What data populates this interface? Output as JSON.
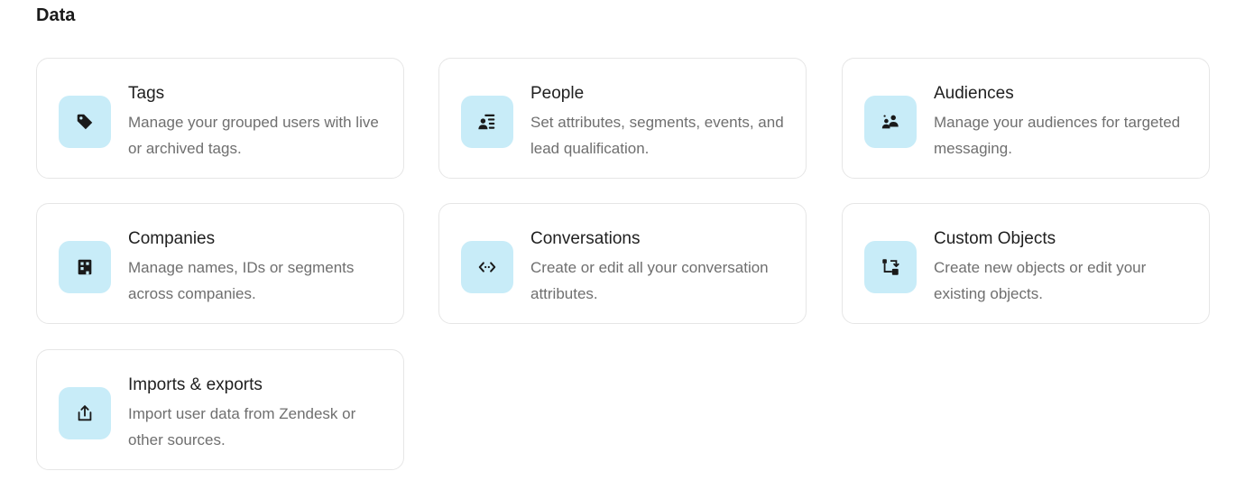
{
  "section": {
    "title": "Data"
  },
  "cards": [
    {
      "title": "Tags",
      "description": "Manage your grouped users with live or archived tags.",
      "icon": "tag-icon"
    },
    {
      "title": "People",
      "description": "Set attributes, segments, events, and lead qualification.",
      "icon": "people-icon"
    },
    {
      "title": "Audiences",
      "description": "Manage your audiences for targeted messaging.",
      "icon": "audiences-icon"
    },
    {
      "title": "Companies",
      "description": "Manage names, IDs or segments across companies.",
      "icon": "building-icon"
    },
    {
      "title": "Conversations",
      "description": "Create or edit all your conversation attributes.",
      "icon": "code-arrows-icon"
    },
    {
      "title": "Custom Objects",
      "description": "Create new objects or edit your existing objects.",
      "icon": "custom-objects-icon"
    },
    {
      "title": "Imports & exports",
      "description": "Import user data from Zendesk or other sources.",
      "icon": "upload-icon"
    }
  ],
  "colors": {
    "icon_tile_background": "#c8ecf8",
    "icon_glyph": "#1a1a1a",
    "card_border": "#e6e6e6",
    "title_text": "#1f1f1f",
    "description_text": "#6f6f6f"
  }
}
